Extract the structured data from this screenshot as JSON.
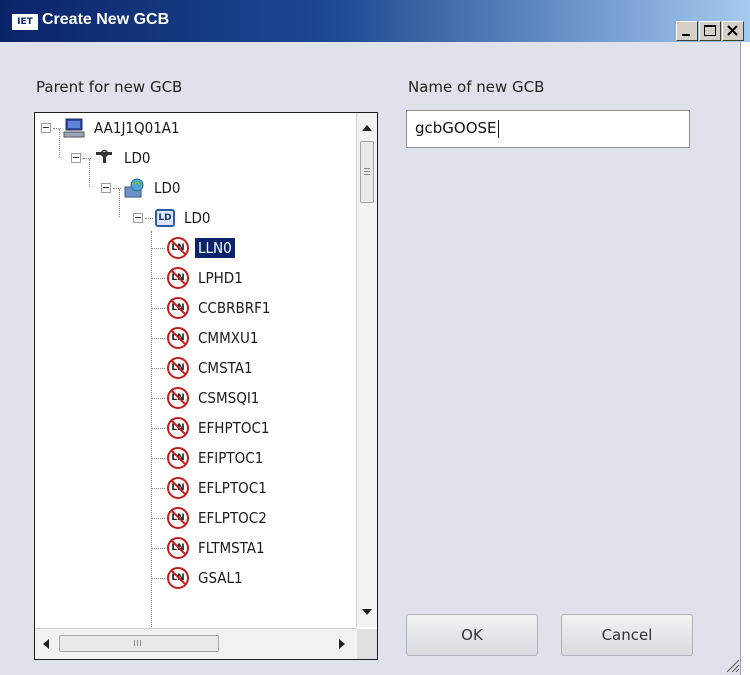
{
  "window": {
    "title": "Create New GCB",
    "app_icon_text": "IET",
    "controls": [
      "minimize-icon",
      "maximize-icon",
      "close-icon"
    ]
  },
  "left_panel": {
    "label": "Parent for new GCB"
  },
  "right_panel": {
    "label": "Name of new GCB"
  },
  "name_field": {
    "value": "gcbGOOSE"
  },
  "tree": {
    "root": {
      "label": "AA1J1Q01A1",
      "icon": "computer-icon"
    },
    "level1": {
      "label": "LD0",
      "icon": "access-point-icon"
    },
    "level2": {
      "label": "LD0",
      "icon": "server-globe-icon"
    },
    "level3": {
      "label": "LD0",
      "icon": "logical-device-icon",
      "icon_text": "LD"
    },
    "ln_icon_text": "LN",
    "nodes": [
      {
        "label": "LLN0",
        "selected": true
      },
      {
        "label": "LPHD1"
      },
      {
        "label": "CCBRBRF1"
      },
      {
        "label": "CMMXU1"
      },
      {
        "label": "CMSTA1"
      },
      {
        "label": "CSMSQI1"
      },
      {
        "label": "EFHPTOC1"
      },
      {
        "label": "EFIPTOC1"
      },
      {
        "label": "EFLPTOC1"
      },
      {
        "label": "EFLPTOC2"
      },
      {
        "label": "FLTMSTA1"
      },
      {
        "label": "GSAL1"
      }
    ]
  },
  "buttons": {
    "ok": "OK",
    "cancel": "Cancel"
  },
  "colors": {
    "title_bar": "#0a246a",
    "selection": "#0a246a",
    "ln_icon": "#c41a1a"
  }
}
